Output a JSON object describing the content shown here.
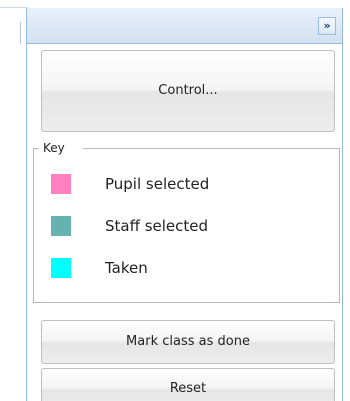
{
  "panel": {
    "collapse_glyph": "»",
    "control_button": "Control...",
    "key": {
      "legend": "Key",
      "items": [
        {
          "label": "Pupil selected",
          "color": "#ff80c0"
        },
        {
          "label": "Staff selected",
          "color": "#66b2b0"
        },
        {
          "label": "Taken",
          "color": "#00ffff"
        }
      ]
    },
    "mark_button": "Mark class as done",
    "reset_button": "Reset"
  }
}
